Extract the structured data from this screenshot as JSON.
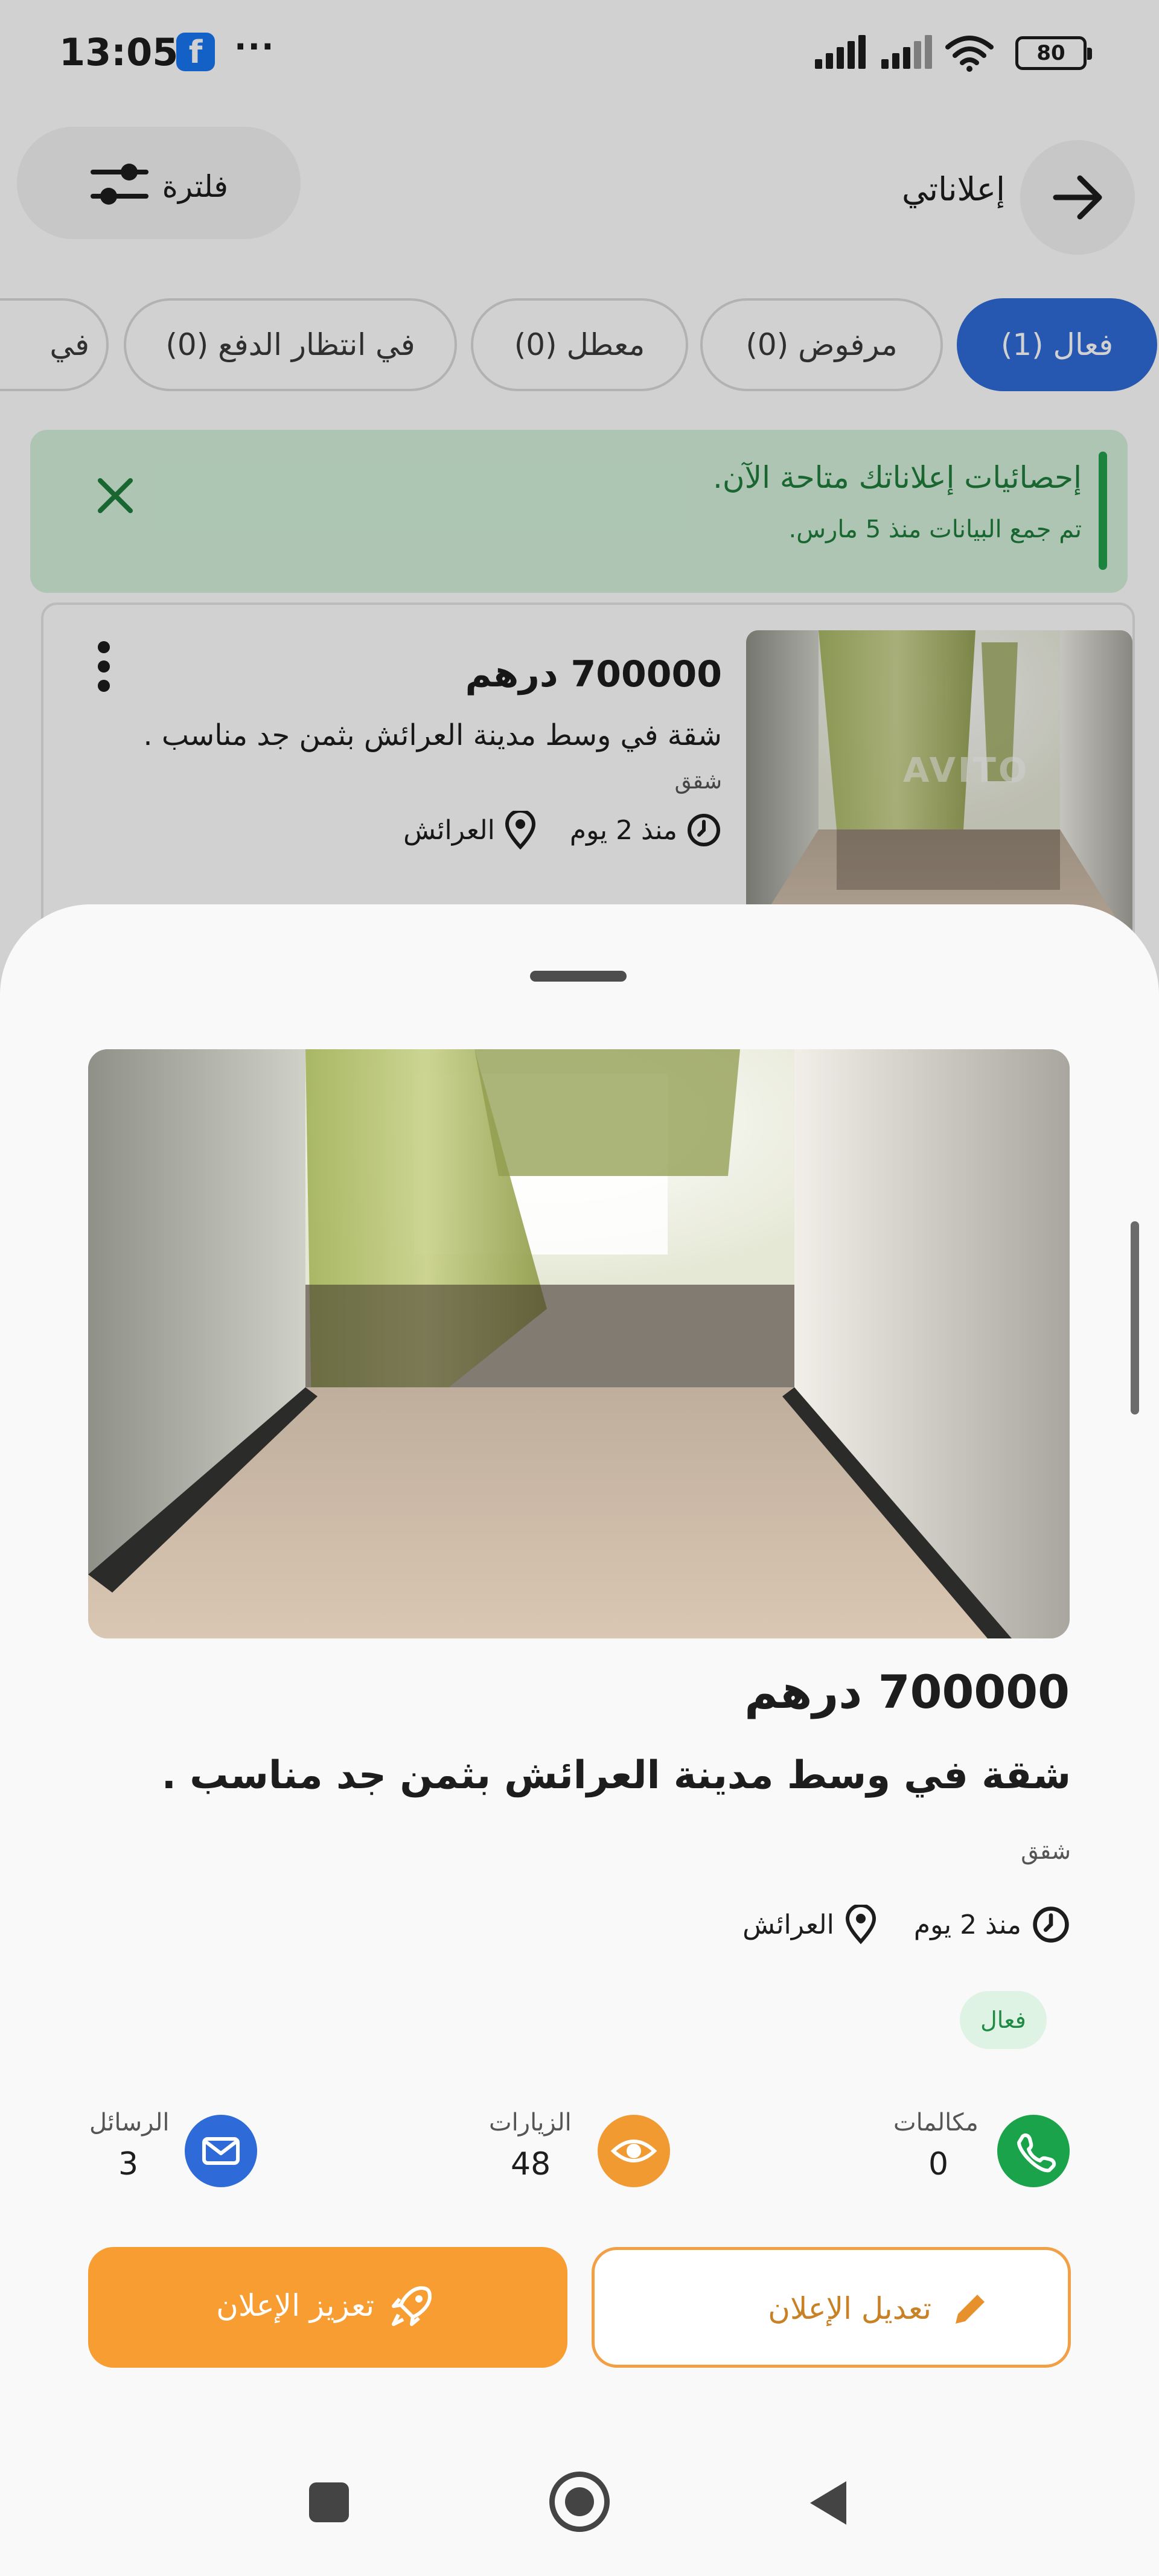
{
  "status_bar": {
    "time": "13:05",
    "app_badge": "f",
    "more": "···",
    "battery": "80"
  },
  "header": {
    "title": "إعلاناتي",
    "filter_label": "فلترة"
  },
  "tabs": [
    {
      "label": "فعال (1)",
      "active": true
    },
    {
      "label": "مرفوض (0)",
      "active": false
    },
    {
      "label": "معطل (0)",
      "active": false
    },
    {
      "label": "في انتظار الدفع (0)",
      "active": false
    },
    {
      "label": "في",
      "active": false
    }
  ],
  "stats_banner": {
    "title": "إحصائيات إعلاناتك متاحة الآن.",
    "subtitle": "تم جمع البيانات منذ 5 مارس."
  },
  "ad": {
    "price": "700000 درهم",
    "description": "شقة في وسط مدينة العرائش بثمن جد مناسب .",
    "category": "شقق",
    "time_ago": "منذ 2 يوم",
    "location": "العرائش",
    "status": "فعال",
    "watermark": "AVITO"
  },
  "stats": {
    "calls": {
      "label": "مكالمات",
      "value": "0",
      "color": "#1aa34a"
    },
    "visits": {
      "label": "الزيارات",
      "value": "48",
      "color": "#f29a32"
    },
    "messages": {
      "label": "الرسائل",
      "value": "3",
      "color": "#2f6bd8"
    }
  },
  "actions": {
    "edit_label": "تعديل الإعلان",
    "boost_label": "تعزيز الإعلان"
  },
  "colors": {
    "primary": "#2f6bd8",
    "accent": "#f79d32",
    "success": "#1aa34a"
  }
}
